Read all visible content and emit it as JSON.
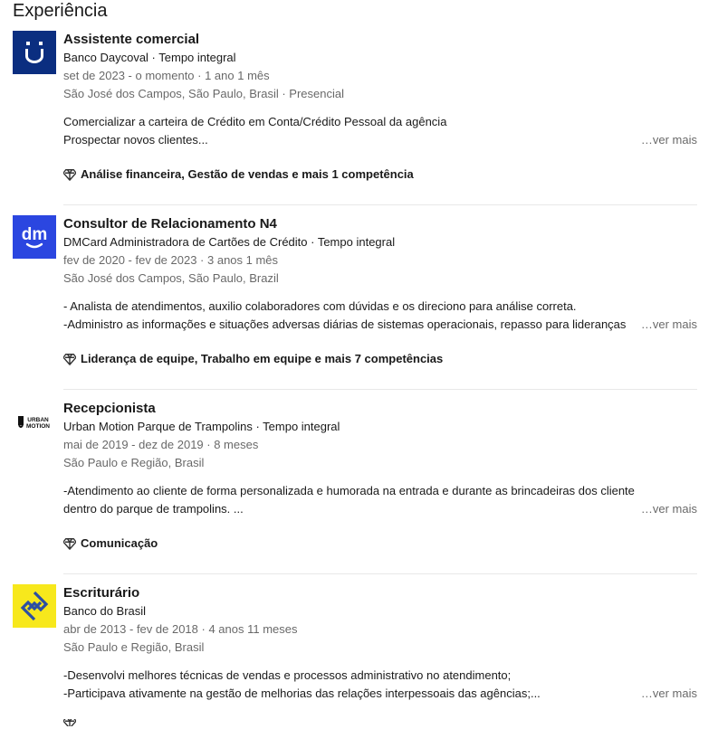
{
  "section": {
    "title": "Experiência"
  },
  "experiences": [
    {
      "logo": {
        "bg": "#0a2a7a",
        "fg": "#ffffff"
      },
      "role": "Assistente comercial",
      "company": "Banco Daycoval · Tempo integral",
      "dates": "set de 2023 - o momento · 1 ano 1 mês",
      "location": "São José dos Campos, São Paulo, Brasil · Presencial",
      "desc1": "Comercializar a carteira de Crédito em Conta/Crédito Pessoal da agência",
      "desc2": "Prospectar novos clientes...",
      "more": "…ver mais",
      "skills": "Análise financeira, Gestão de vendas e mais 1 competência"
    },
    {
      "logo": {
        "bg": "#2b46e0",
        "fg": "#ffffff",
        "text": "dm"
      },
      "role": "Consultor de Relacionamento N4",
      "company": "DMCard Administradora de Cartões de Crédito · Tempo integral",
      "dates": "fev de 2020 - fev de 2023 · 3 anos 1 mês",
      "location": "São José dos Campos, São Paulo, Brazil",
      "desc1": "- Analista de atendimentos, auxilio colaboradores com dúvidas e os direciono para análise correta.",
      "desc2": "-Administro as informações e situações adversas diárias de sistemas operacionais, repasso para lideranças",
      "more": "…ver mais",
      "skills": "Liderança de equipe, Trabalho em equipe e mais 7 competências"
    },
    {
      "logo": {
        "bg": "#ffffff",
        "fg": "#111111",
        "text": "URBAN MOTION"
      },
      "role": "Recepcionista",
      "company": "Urban Motion Parque de Trampolins · Tempo integral",
      "dates": "mai de 2019 - dez de 2019 · 8 meses",
      "location": "São Paulo e Região, Brasil",
      "desc1": "-Atendimento ao cliente de forma personalizada e humorada na entrada e durante as brincadeiras dos cliente",
      "desc2": "dentro do parque de trampolins. ...",
      "more": "…ver mais",
      "skills": "Comunicação"
    },
    {
      "logo": {
        "bg": "#f5e71a",
        "fg": "#2a4d9c"
      },
      "role": "Escriturário",
      "company": "Banco do Brasil",
      "dates": "abr de 2013 - fev de 2018 · 4 anos 11 meses",
      "location": "São Paulo e Região, Brasil",
      "desc1": "-Desenvolvi melhores técnicas de vendas e processos administrativo no atendimento;",
      "desc2": "-Participava ativamente na gestão de melhorias das relações interpessoais das agências;...",
      "more": "…ver mais",
      "skills": ""
    }
  ]
}
